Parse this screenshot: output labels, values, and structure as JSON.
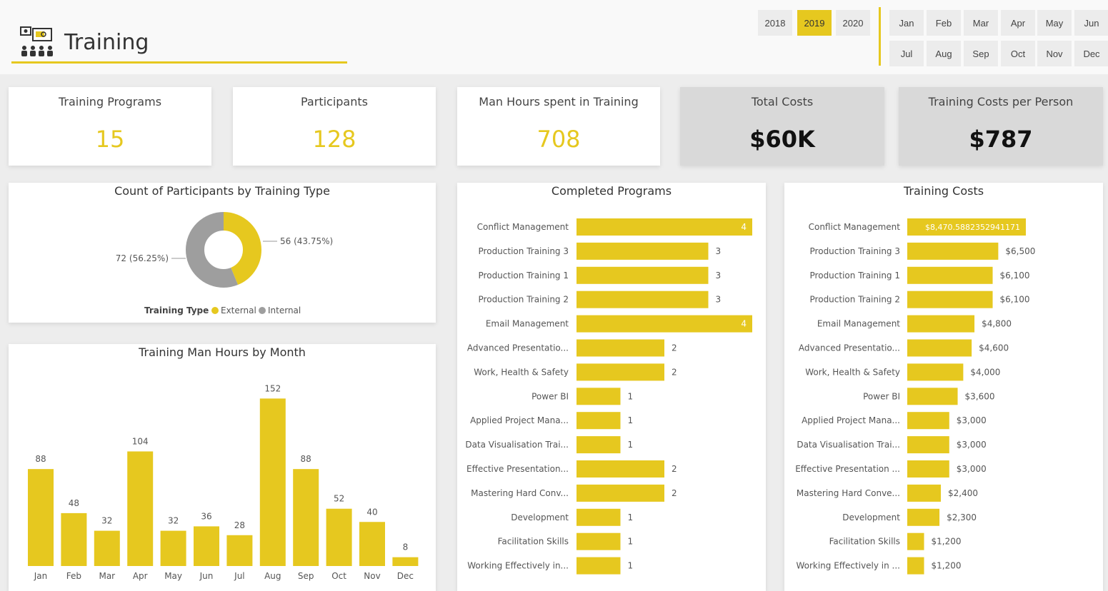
{
  "header": {
    "title": "Training",
    "years": [
      {
        "label": "2018",
        "active": false
      },
      {
        "label": "2019",
        "active": true
      },
      {
        "label": "2020",
        "active": false
      }
    ],
    "months": [
      "Jan",
      "Feb",
      "Mar",
      "Apr",
      "May",
      "Jun",
      "Jul",
      "Aug",
      "Sep",
      "Oct",
      "Nov",
      "Dec"
    ]
  },
  "kpis": [
    {
      "title": "Training Programs",
      "value": "15"
    },
    {
      "title": "Participants",
      "value": "128"
    },
    {
      "title": "Man Hours spent in Training",
      "value": "708"
    },
    {
      "title": "Total Costs",
      "value": "$60K"
    },
    {
      "title": "Training Costs per Person",
      "value": "$787"
    }
  ],
  "colors": {
    "accent": "#e6c81f",
    "internal": "#9e9e9e"
  },
  "chart_data": [
    {
      "type": "pie",
      "title": "Count of Participants by Training Type",
      "legend_title": "Training Type",
      "categories": [
        "External",
        "Internal"
      ],
      "values": [
        56,
        72
      ],
      "value_labels": [
        "56 (43.75%)",
        "72 (56.25%)"
      ],
      "legend": "bottom"
    },
    {
      "type": "bar",
      "title": "Training Man Hours by Month",
      "categories": [
        "Jan",
        "Feb",
        "Mar",
        "Apr",
        "May",
        "Jun",
        "Jul",
        "Aug",
        "Sep",
        "Oct",
        "Nov",
        "Dec"
      ],
      "values": [
        88,
        48,
        32,
        104,
        32,
        36,
        28,
        152,
        88,
        52,
        40,
        8
      ],
      "ylim": [
        0,
        160
      ]
    },
    {
      "type": "bar",
      "orientation": "horizontal",
      "title": "Completed Programs",
      "categories": [
        "Conflict Management",
        "Production Training 3",
        "Production Training 1",
        "Production Training 2",
        "Email Management",
        "Advanced Presentatio...",
        "Work, Health & Safety",
        "Power BI",
        "Applied Project Mana...",
        "Data Visualisation Trai...",
        "Effective Presentation...",
        "Mastering Hard Conv...",
        "Development",
        "Facilitation Skills",
        "Working Effectively in..."
      ],
      "values": [
        4,
        3,
        3,
        3,
        4,
        2,
        2,
        1,
        1,
        1,
        2,
        2,
        1,
        1,
        1
      ],
      "value_labels": [
        "4",
        "3",
        "3",
        "3",
        "4",
        "2",
        "2",
        "1",
        "1",
        "1",
        "2",
        "2",
        "1",
        "1",
        "1"
      ],
      "xlim": [
        0,
        4
      ]
    },
    {
      "type": "bar",
      "orientation": "horizontal",
      "title": "Training Costs",
      "categories": [
        "Conflict Management",
        "Production Training 3",
        "Production Training 1",
        "Production Training 2",
        "Email Management",
        "Advanced Presentatio...",
        "Work, Health & Safety",
        "Power BI",
        "Applied Project Mana...",
        "Data Visualisation Trai...",
        "Effective Presentation ...",
        "Mastering Hard Conve...",
        "Development",
        "Facilitation Skills",
        "Working Effectively in ..."
      ],
      "values": [
        8470.59,
        6500,
        6100,
        6100,
        4800,
        4600,
        4000,
        3600,
        3000,
        3000,
        3000,
        2400,
        2300,
        1200,
        1200
      ],
      "value_labels": [
        "$8,470.5882352941171",
        "$6,500",
        "$6,100",
        "$6,100",
        "$4,800",
        "$4,600",
        "$4,000",
        "$3,600",
        "$3,000",
        "$3,000",
        "$3,000",
        "$2,400",
        "$2,300",
        "$1,200",
        "$1,200"
      ],
      "xlim": [
        0,
        8470.59
      ]
    }
  ]
}
